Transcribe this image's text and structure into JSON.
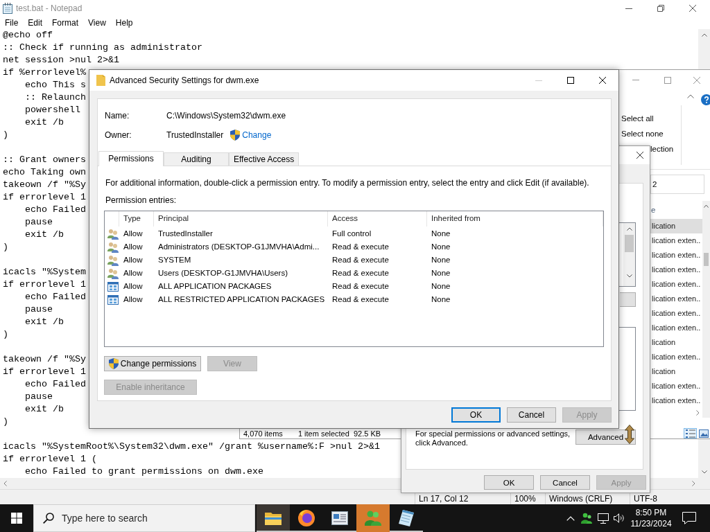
{
  "notepad": {
    "title": "test.bat - Notepad",
    "menu": [
      "File",
      "Edit",
      "Format",
      "View",
      "Help"
    ],
    "blocks": [
      [
        "@echo off",
        ":: Check if running as administrator",
        "net session >nul 2>&1",
        "if %errorlevel%",
        "    echo This s",
        "    :: Relaunch",
        "    powershell",
        "    exit /b",
        ")"
      ],
      [
        ":: Grant owners",
        "echo Taking own",
        "takeown /f \"%Sy",
        "if errorlevel 1",
        "    echo Failed",
        "    pause",
        "    exit /b",
        ")"
      ],
      [
        "icacls \"%System",
        "if errorlevel 1",
        "    echo Failed",
        "    pause",
        "    exit /b",
        ")"
      ],
      [
        "takeown /f \"%Sy",
        "if errorlevel 1",
        "    echo Failed",
        "    pause",
        "    exit /b",
        ")"
      ],
      [
        "icacls \"%SystemRoot%\\System32\\dwm.exe\" /grant %username%:F >nul 2>&1",
        "if errorlevel 1 (",
        "    echo Failed to grant permissions on dwm.exe"
      ]
    ],
    "status_bar": [
      "Ln 17, Col 12",
      "100%",
      "Windows (CRLF)",
      "UTF-8"
    ]
  },
  "explorer": {
    "ribbon": [
      "Select all",
      "Select none",
      "lection"
    ],
    "search": {
      "value": "2"
    },
    "column_header": "e",
    "rows": [
      {
        "name": "lication",
        "selected": true
      },
      {
        "name": "lication exten..",
        "selected": false
      },
      {
        "name": "lication exten..",
        "selected": false
      },
      {
        "name": "lication exten..",
        "selected": false
      },
      {
        "name": "lication exten..",
        "selected": false
      },
      {
        "name": "lication exten..",
        "selected": false
      },
      {
        "name": "lication exten..",
        "selected": false
      },
      {
        "name": "lication exten..",
        "selected": false
      },
      {
        "name": "lication",
        "selected": false
      },
      {
        "name": "lication exten..",
        "selected": false
      },
      {
        "name": "lication",
        "selected": false
      },
      {
        "name": "lication exten..",
        "selected": false
      },
      {
        "name": "lication exten..",
        "selected": false
      }
    ],
    "status_bar": [
      "4,070 items",
      "1 item selected  92.5 KB"
    ],
    "views": [
      {
        "kind": "details",
        "selected": true
      },
      {
        "kind": "large-icons",
        "selected": false
      }
    ]
  },
  "properties": {
    "note": "For special permissions or advanced settings,\nclick Advanced.",
    "advanced_button": "Advanced",
    "buttons": [
      {
        "label": "OK",
        "disabled": false
      },
      {
        "label": "Cancel",
        "disabled": false
      },
      {
        "label": "Apply",
        "disabled": true
      }
    ]
  },
  "advanced_dialog": {
    "title": "Advanced Security Settings for dwm.exe",
    "title_buttons": [
      {
        "kind": "minimize",
        "disabled": true
      },
      {
        "kind": "maximize",
        "disabled": false
      },
      {
        "kind": "close",
        "disabled": false
      }
    ],
    "fields": [
      {
        "label": "Name:",
        "value": "C:\\Windows\\System32\\dwm.exe"
      },
      {
        "label": "Owner:",
        "value": "TrustedInstaller",
        "link": "Change"
      }
    ],
    "tabs": [
      {
        "label": "Permissions",
        "selected": true
      },
      {
        "label": "Auditing",
        "selected": false
      },
      {
        "label": "Effective Access",
        "selected": false
      }
    ],
    "info": "For additional information, double-click a permission entry. To modify a permission entry, select the entry and click Edit (if available).",
    "entries_label": "Permission entries:",
    "columns": [
      "Type",
      "Principal",
      "Access",
      "Inherited from"
    ],
    "entries": [
      {
        "kind": "group",
        "type": "Allow",
        "principal": "TrustedInstaller",
        "access": "Full control",
        "inherited_from": "None"
      },
      {
        "kind": "group",
        "type": "Allow",
        "principal": "Administrators (DESKTOP-G1JMVHA\\Admi...",
        "access": "Read & execute",
        "inherited_from": "None"
      },
      {
        "kind": "group",
        "type": "Allow",
        "principal": "SYSTEM",
        "access": "Read & execute",
        "inherited_from": "None"
      },
      {
        "kind": "group",
        "type": "Allow",
        "principal": "Users (DESKTOP-G1JMVHA\\Users)",
        "access": "Read & execute",
        "inherited_from": "None"
      },
      {
        "kind": "package",
        "type": "Allow",
        "principal": "ALL APPLICATION PACKAGES",
        "access": "Read & execute",
        "inherited_from": "None"
      },
      {
        "kind": "package",
        "type": "Allow",
        "principal": "ALL RESTRICTED APPLICATION PACKAGES",
        "access": "Read & execute",
        "inherited_from": "None"
      }
    ],
    "buttons": [
      [
        {
          "label": "Change permissions",
          "shield": true,
          "disabled": false
        },
        {
          "label": "View",
          "shield": false,
          "disabled": true
        }
      ],
      [
        {
          "label": "Enable inheritance",
          "shield": false,
          "disabled": true
        }
      ]
    ],
    "footer_buttons": [
      {
        "label": "OK",
        "default": true,
        "disabled": false
      },
      {
        "label": "Cancel",
        "default": false,
        "disabled": false
      },
      {
        "label": "Apply",
        "default": false,
        "disabled": true
      }
    ]
  },
  "taskbar": {
    "search": {
      "placeholder": "Type here to search"
    },
    "apps": [
      {
        "kind": "folder",
        "selected": true,
        "attention": false,
        "running": true
      },
      {
        "kind": "ring",
        "selected": false,
        "attention": false,
        "running": true
      },
      {
        "kind": "document",
        "selected": false,
        "attention": false,
        "running": true
      },
      {
        "kind": "people",
        "selected": false,
        "attention": true,
        "running": false
      },
      {
        "kind": "notepad",
        "selected": false,
        "attention": false,
        "running": true
      }
    ],
    "clock": {
      "time": "8:50 PM",
      "date": "11/23/2024"
    }
  }
}
